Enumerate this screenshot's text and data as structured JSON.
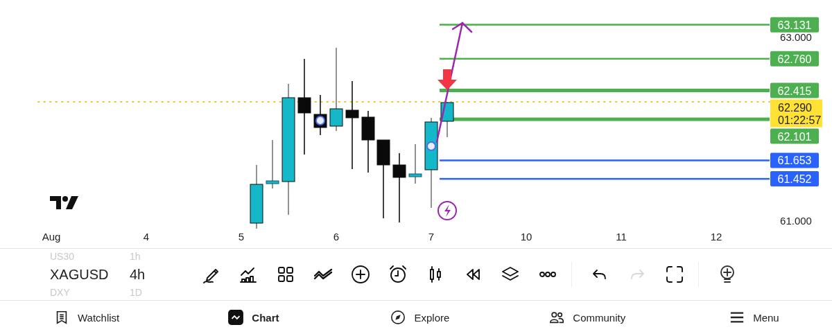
{
  "chart": {
    "price_levels": [
      {
        "price": "63.131",
        "color": "#4caf50",
        "emphasized": false
      },
      {
        "price": "62.760",
        "color": "#4caf50",
        "emphasized": false
      },
      {
        "price": "62.415",
        "color": "#4caf50",
        "emphasized": true
      },
      {
        "price": "62.101",
        "color": "#4caf50",
        "emphasized": true
      },
      {
        "price": "61.653",
        "color": "#2962ff",
        "emphasized": false
      },
      {
        "price": "61.452",
        "color": "#2962ff",
        "emphasized": false
      }
    ],
    "current_price": {
      "price": "62.290",
      "countdown": "01:22:57"
    },
    "price_ticks": [
      "63.000",
      "61.000"
    ],
    "date_ticks": [
      "Aug",
      "4",
      "5",
      "6",
      "7",
      "10",
      "11",
      "12"
    ]
  },
  "symbols": [
    {
      "symbol": "US30",
      "interval": "1h",
      "selected": false
    },
    {
      "symbol": "XAGUSD",
      "interval": "4h",
      "selected": true
    },
    {
      "symbol": "DXY",
      "interval": "1D",
      "selected": false
    }
  ],
  "toolbar": {
    "redo": {
      "disabled": true
    }
  },
  "nav": [
    {
      "label": "Watchlist",
      "selected": false
    },
    {
      "label": "Chart",
      "selected": true
    },
    {
      "label": "Explore",
      "selected": false
    },
    {
      "label": "Community",
      "selected": false
    },
    {
      "label": "Menu",
      "selected": false
    }
  ]
}
